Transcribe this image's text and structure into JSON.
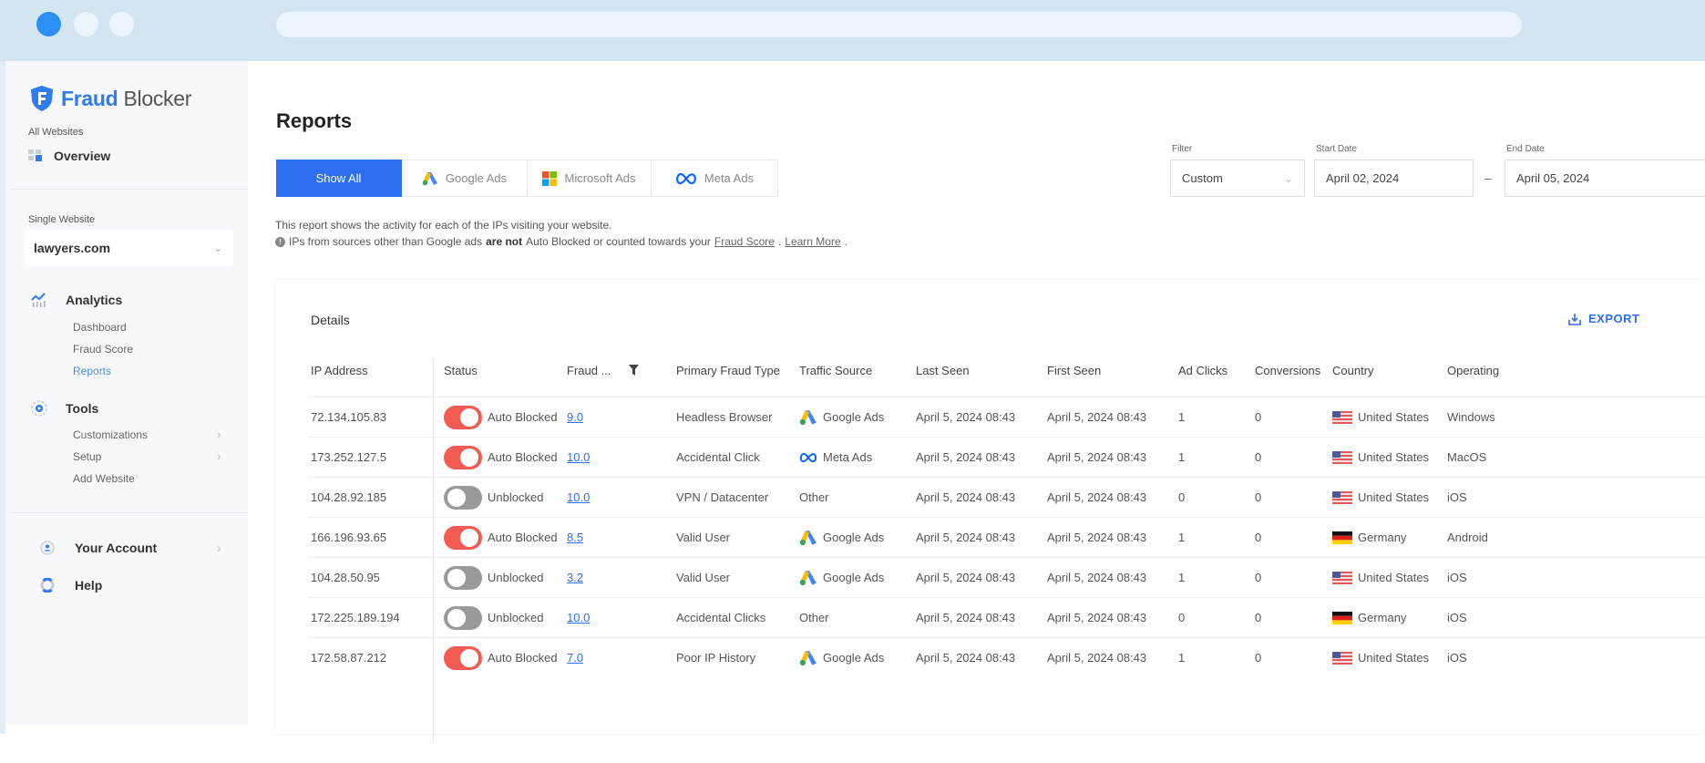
{
  "brand": {
    "part1": "Fraud",
    "part2": "Blocker",
    "accent": "#2f7bf0"
  },
  "sidebar": {
    "all_websites_label": "All Websites",
    "overview_label": "Overview",
    "single_website_label": "Single Website",
    "site_select_value": "lawyers.com",
    "analytics": {
      "label": "Analytics",
      "items": [
        "Dashboard",
        "Fraud Score",
        "Reports"
      ],
      "active": "Reports"
    },
    "tools": {
      "label": "Tools",
      "items": [
        "Customizations",
        "Setup",
        "Add Website"
      ]
    },
    "account_label": "Your Account",
    "help_label": "Help"
  },
  "main": {
    "title": "Reports",
    "tabs": [
      {
        "label": "Show All",
        "icon": "none",
        "active": true
      },
      {
        "label": "Google Ads",
        "icon": "google-ads-icon",
        "active": false
      },
      {
        "label": "Microsoft Ads",
        "icon": "microsoft-icon",
        "active": false
      },
      {
        "label": "Meta Ads",
        "icon": "meta-icon",
        "active": false
      }
    ],
    "info_line1": "This report shows the activity for each of the IPs visiting your website.",
    "info_line2_pre": "IPs from sources other than Google ads",
    "info_line2_bold": "are not",
    "info_line2_post": "Auto Blocked or counted towards your",
    "info_link_fraud": "Fraud Score",
    "info_link_learn": "Learn More",
    "filter": {
      "label": "Filter",
      "value": "Custom"
    },
    "start_date": {
      "label": "Start Date",
      "value": "April 02, 2024"
    },
    "end_date": {
      "label": "End Date",
      "value": "April 05, 2024"
    },
    "date_separator": "–"
  },
  "details": {
    "title": "Details",
    "export_label": "EXPORT",
    "columns": [
      "IP Address",
      "Status",
      "Fraud ...",
      "Primary Fraud Type",
      "Traffic Source",
      "Last Seen",
      "First Seen",
      "Ad Clicks",
      "Conversions",
      "Country",
      "Operating"
    ],
    "rows": [
      {
        "ip": "72.134.105.83",
        "status": "Auto Blocked",
        "blocked": true,
        "score": "9.0",
        "type": "Headless Browser",
        "source": "Google Ads",
        "last": "April 5, 2024 08:43",
        "first": "April 5, 2024 08:43",
        "clicks": "1",
        "conv": "0",
        "country": "United States",
        "os": "Windows"
      },
      {
        "ip": "173.252.127.5",
        "status": "Auto Blocked",
        "blocked": true,
        "score": "10.0",
        "type": "Accidental Click",
        "source": "Meta Ads",
        "last": "April 5, 2024 08:43",
        "first": "April 5, 2024 08:43",
        "clicks": "1",
        "conv": "0",
        "country": "United States",
        "os": "MacOS"
      },
      {
        "ip": "104.28.92.185",
        "status": "Unblocked",
        "blocked": false,
        "score": "10.0",
        "type": "VPN / Datacenter",
        "source": "Other",
        "last": "April 5, 2024 08:43",
        "first": "April 5, 2024 08:43",
        "clicks": "0",
        "conv": "0",
        "country": "United States",
        "os": "iOS"
      },
      {
        "ip": "166.196.93.65",
        "status": "Auto Blocked",
        "blocked": true,
        "score": "8.5",
        "type": "Valid User",
        "source": "Google Ads",
        "last": "April 5, 2024 08:43",
        "first": "April 5, 2024 08:43",
        "clicks": "1",
        "conv": "0",
        "country": "Germany",
        "os": "Android"
      },
      {
        "ip": "104.28.50.95",
        "status": "Unblocked",
        "blocked": false,
        "score": "3.2",
        "type": "Valid User",
        "source": "Google Ads",
        "last": "April 5, 2024 08:43",
        "first": "April 5, 2024 08:43",
        "clicks": "1",
        "conv": "0",
        "country": "United States",
        "os": "iOS"
      },
      {
        "ip": "172.225.189.194",
        "status": "Unblocked",
        "blocked": false,
        "score": "10.0",
        "type": "Accidental Clicks",
        "source": "Other",
        "last": "April 5, 2024 08:43",
        "first": "April 5, 2024 08:43",
        "clicks": "0",
        "conv": "0",
        "country": "Germany",
        "os": "iOS"
      },
      {
        "ip": "172.58.87.212",
        "status": "Auto Blocked",
        "blocked": true,
        "score": "7.0",
        "type": "Poor IP History",
        "source": "Google Ads",
        "last": "April 5, 2024 08:43",
        "first": "April 5, 2024 08:43",
        "clicks": "1",
        "conv": "0",
        "country": "United States",
        "os": "iOS"
      }
    ]
  },
  "colors": {
    "primary": "#2e6ff2",
    "blocked": "#f25a52",
    "unblocked": "#999999"
  }
}
